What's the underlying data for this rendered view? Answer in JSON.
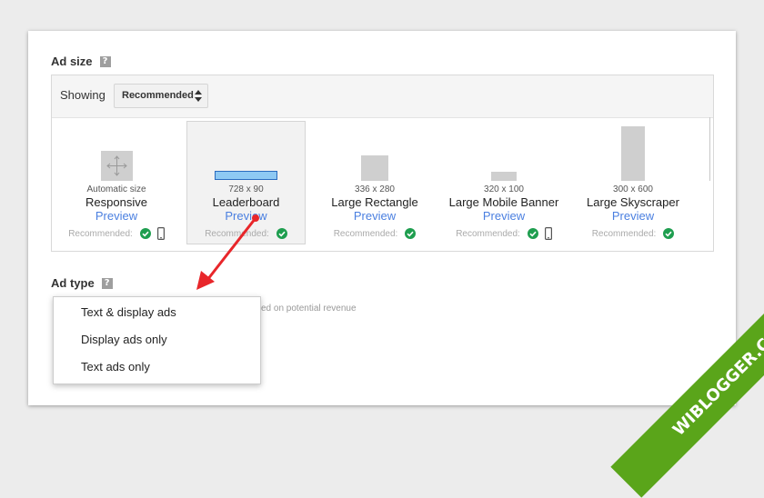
{
  "ad_size": {
    "title": "Ad size",
    "help": "?",
    "showing_label": "Showing",
    "select_value": "Recommended",
    "items": [
      {
        "dims": "Automatic size",
        "name": "Responsive",
        "preview": "Preview",
        "recommended": "Recommended:",
        "mobile": true,
        "selected": false
      },
      {
        "dims": "728 x 90",
        "name": "Leaderboard",
        "preview": "Preview",
        "recommended": "Recommended:",
        "mobile": false,
        "selected": true
      },
      {
        "dims": "336 x 280",
        "name": "Large Rectangle",
        "preview": "Preview",
        "recommended": "Recommended:",
        "mobile": false,
        "selected": false
      },
      {
        "dims": "320 x 100",
        "name": "Large Mobile Banner",
        "preview": "Preview",
        "recommended": "Recommended:",
        "mobile": true,
        "selected": false
      },
      {
        "dims": "300 x 600",
        "name": "Large Skyscraper",
        "preview": "Preview",
        "recommended": "Recommended:",
        "mobile": false,
        "selected": false
      }
    ]
  },
  "ad_type": {
    "title": "Ad type",
    "help": "?",
    "background_text": "ed on potential revenue",
    "options": [
      "Text & display ads",
      "Display ads only",
      "Text ads only"
    ]
  },
  "watermark": {
    "text": "WIBLOGGER.COM"
  },
  "colors": {
    "check_green": "#1e9e4f",
    "link_blue": "#4a7fe0",
    "arrow_red": "#e8262a",
    "ribbon_green": "#5aa51a",
    "leaderboard_fill": "#8ec9f3"
  }
}
